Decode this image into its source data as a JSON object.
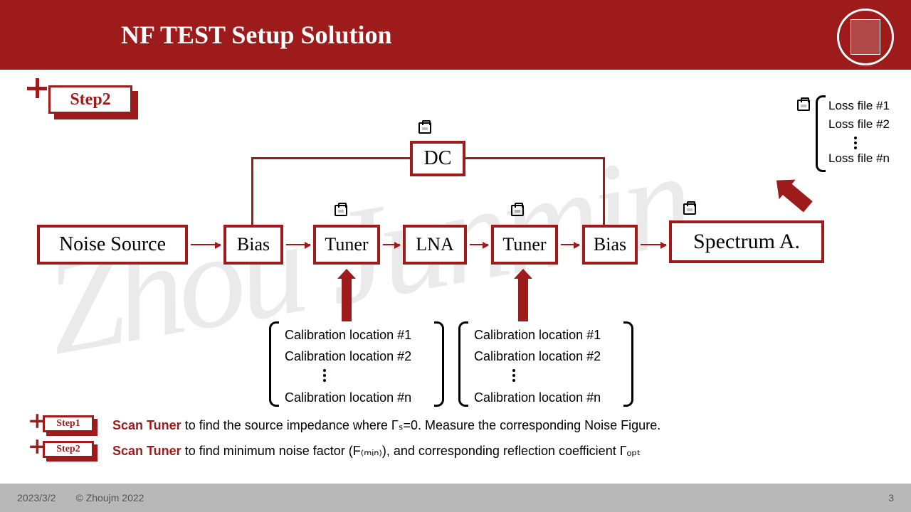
{
  "header": {
    "title": "NF TEST Setup Solution"
  },
  "watermark": "Zhou Junmin",
  "badge_main": "Step2",
  "blocks": {
    "noise_source": "Noise Source",
    "bias1": "Bias",
    "tuner1": "Tuner",
    "lna": "LNA",
    "tuner2": "Tuner",
    "bias2": "Bias",
    "spectrum": "Spectrum A.",
    "dc": "DC"
  },
  "cal_list": {
    "l1": "Calibration location #1",
    "l2": "Calibration location #2",
    "ln": "Calibration location #n"
  },
  "loss_list": {
    "l1": "Loss file #1",
    "l2": "Loss file #2",
    "ln": "Loss file #n"
  },
  "mini_steps": {
    "s1_label": "Step1",
    "s2_label": "Step2",
    "s1_b": "Scan Tuner",
    "s1_rest": " to find the source impedance where Γₛ=0. Measure the corresponding Noise Figure.",
    "s2_b": "Scan Tuner",
    "s2_rest": " to find minimum noise factor (F₍ₘᵢₙ₎), and corresponding reflection coefficient Γₒₚₜ"
  },
  "footer": {
    "date": "2023/3/2",
    "copyright": "© Zhoujm 2022",
    "page": "3"
  }
}
